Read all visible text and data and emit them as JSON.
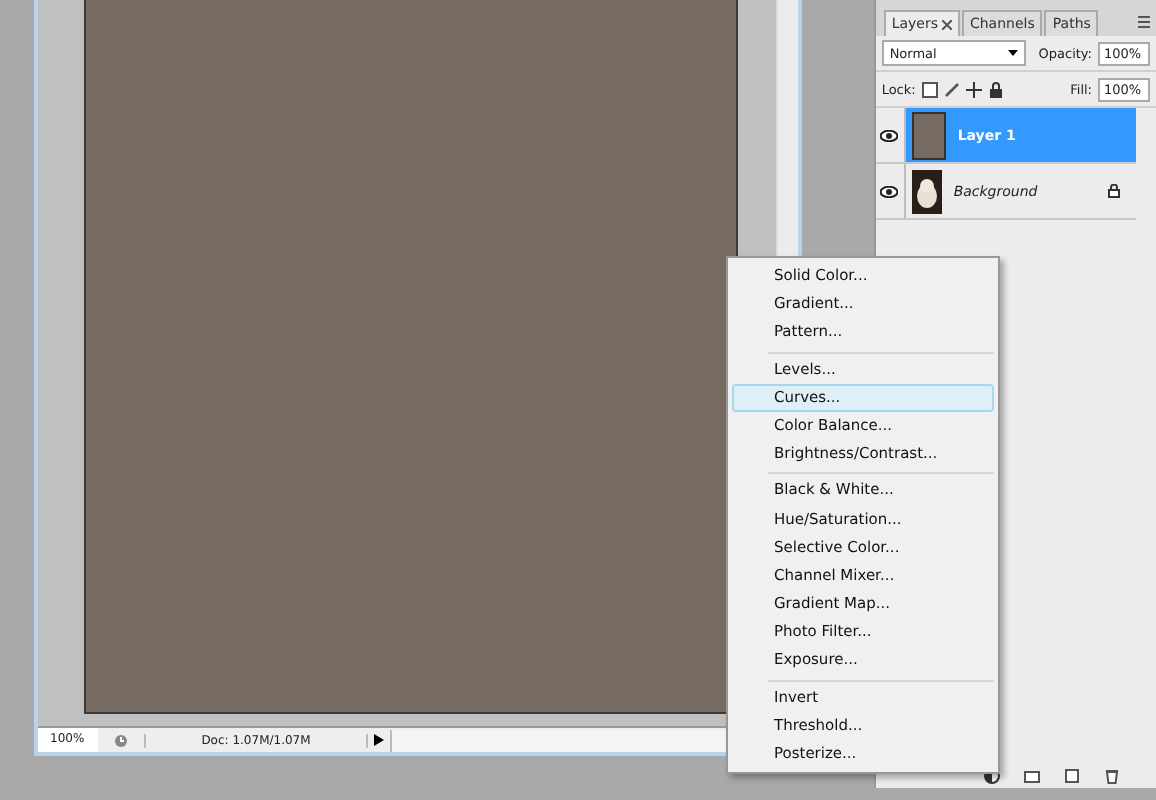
{
  "document": {
    "zoom": "100%",
    "doc_info": "Doc: 1.07M/1.07M"
  },
  "layers_panel": {
    "tabs": [
      {
        "label": "Layers",
        "selected": true,
        "closable": true
      },
      {
        "label": "Channels",
        "selected": false,
        "closable": false
      },
      {
        "label": "Paths",
        "selected": false,
        "closable": false
      }
    ],
    "blend_mode": "Normal",
    "opacity_label": "Opacity:",
    "opacity": "100%",
    "lock_label": "Lock:",
    "fill_label": "Fill:",
    "fill": "100%",
    "layers": [
      {
        "name": "Layer 1",
        "kind": "fill",
        "selected": true,
        "visible": true,
        "locked": false
      },
      {
        "name": "Background",
        "kind": "background",
        "selected": false,
        "visible": true,
        "locked": true
      }
    ]
  },
  "menu": {
    "sections": [
      [
        {
          "label": "Solid Color...",
          "selected": false
        },
        {
          "label": "Gradient...",
          "selected": false
        },
        {
          "label": "Pattern...",
          "selected": false
        }
      ],
      [
        {
          "label": "Levels...",
          "selected": false
        },
        {
          "label": "Curves...",
          "selected": true
        },
        {
          "label": "Color Balance...",
          "selected": false
        },
        {
          "label": "Brightness/Contrast...",
          "selected": false
        }
      ],
      [
        {
          "label": "Black & White...",
          "selected": false
        },
        {
          "label": "Hue/Saturation...",
          "selected": false
        },
        {
          "label": "Selective Color...",
          "selected": false
        },
        {
          "label": "Channel Mixer...",
          "selected": false
        },
        {
          "label": "Gradient Map...",
          "selected": false
        },
        {
          "label": "Photo Filter...",
          "selected": false
        },
        {
          "label": "Exposure...",
          "selected": false
        }
      ],
      [
        {
          "label": "Invert",
          "selected": false
        },
        {
          "label": "Threshold...",
          "selected": false
        },
        {
          "label": "Posterize...",
          "selected": false
        }
      ]
    ]
  }
}
